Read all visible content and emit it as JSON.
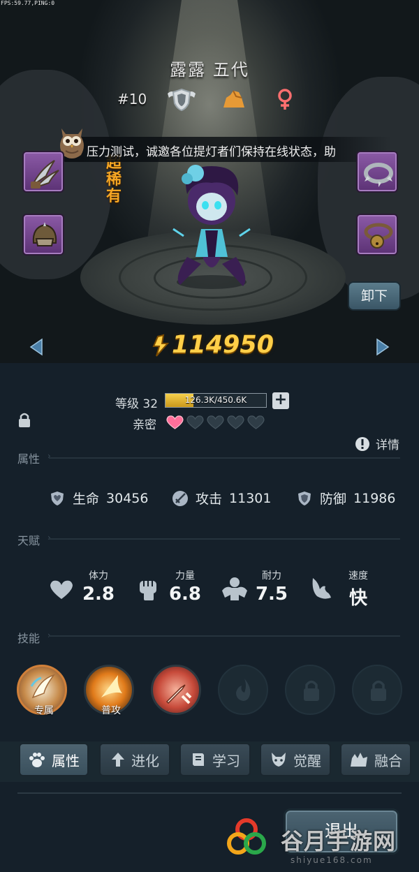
{
  "debug": {
    "fps_text": "FPS:59.77,PING:0"
  },
  "hero": {
    "name": "露露 五代",
    "rank": "#10",
    "rarity": "超稀有",
    "power": "114950"
  },
  "notice": {
    "text": "压力测试，诚邀各位提灯者们保持在线状态，助"
  },
  "buttons": {
    "unequip": "卸下",
    "exit": "退出"
  },
  "progress": {
    "level_label": "等级 32",
    "exp_text": "126.3K/450.6K",
    "exp_fraction": 0.28,
    "intimacy_label": "亲密",
    "hearts_filled": 1,
    "hearts_total": 5
  },
  "detail_label": "详情",
  "sections": {
    "attributes": "属性",
    "talent": "天赋",
    "skills": "技能"
  },
  "stats": [
    {
      "label": "生命",
      "value": "30456",
      "icon": "heart-shield-icon"
    },
    {
      "label": "攻击",
      "value": "11301",
      "icon": "sword-icon"
    },
    {
      "label": "防御",
      "value": "11986",
      "icon": "shield-icon"
    }
  ],
  "talents": [
    {
      "label": "体力",
      "value": "2.8",
      "icon": "heart-icon"
    },
    {
      "label": "力量",
      "value": "6.8",
      "icon": "fist-icon"
    },
    {
      "label": "耐力",
      "value": "7.5",
      "icon": "muscle-icon"
    },
    {
      "label": "速度",
      "value": "快",
      "icon": "wing-icon"
    }
  ],
  "skills": [
    {
      "tag": "专属",
      "state": "unlocked"
    },
    {
      "tag": "普攻",
      "state": "unlocked"
    },
    {
      "tag": "",
      "state": "unlocked"
    },
    {
      "tag": "",
      "state": "empty"
    },
    {
      "tag": "",
      "state": "locked"
    },
    {
      "tag": "",
      "state": "locked"
    }
  ],
  "tabs": [
    {
      "label": "属性",
      "icon": "paw-icon",
      "active": true
    },
    {
      "label": "进化",
      "icon": "arrow-up-icon",
      "active": false
    },
    {
      "label": "学习",
      "icon": "book-icon",
      "active": false
    },
    {
      "label": "觉醒",
      "icon": "wolf-icon",
      "active": false
    },
    {
      "label": "融合",
      "icon": "beast-icon",
      "active": false
    }
  ],
  "watermark": {
    "text": "谷月手游网",
    "url": "shiyue168.com"
  },
  "colors": {
    "power": "#ffcf48",
    "rarity": "#f5a623",
    "heart_filled": "#ff6f9a",
    "panel_bg": "#15202a"
  }
}
